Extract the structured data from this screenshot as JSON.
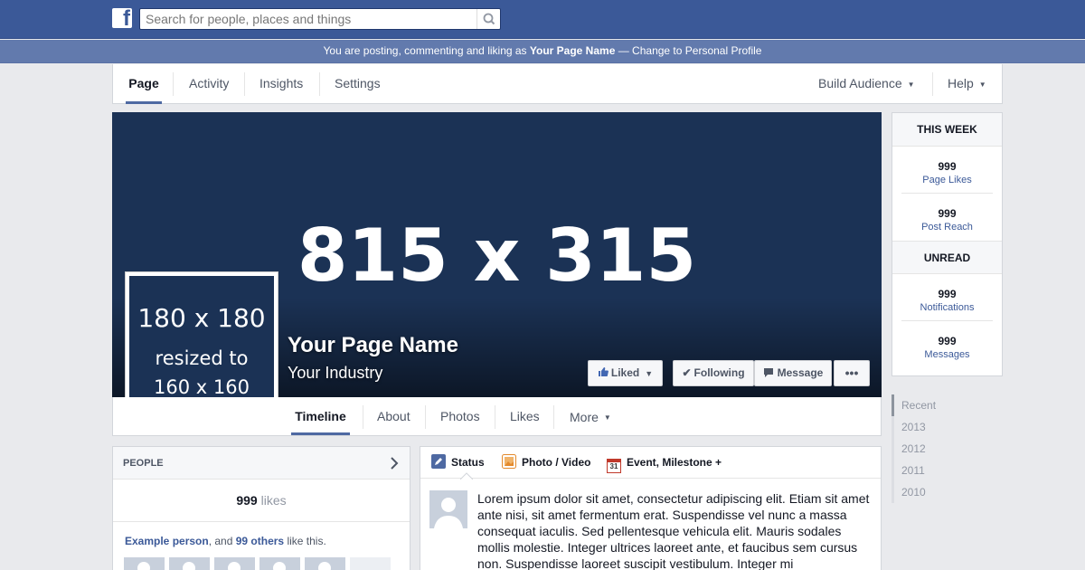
{
  "topbar": {
    "logo_letter": "f",
    "search_placeholder": "Search for people, places and things",
    "brand_color": "#3b5998"
  },
  "notice": {
    "prefix": "You are posting, commenting and liking as",
    "page_name": "Your Page Name",
    "suffix": "— Change to Personal Profile"
  },
  "admin_tabs": {
    "page": "Page",
    "activity": "Activity",
    "insights": "Insights",
    "settings": "Settings",
    "build_audience": "Build Audience",
    "help": "Help"
  },
  "cover": {
    "dimensions": "815 x 315",
    "profile_line1": "180 x 180",
    "profile_line2": "resized to",
    "profile_line3": "160 x 160",
    "page_name": "Your Page Name",
    "industry": "Your Industry"
  },
  "cover_buttons": {
    "liked": "Liked",
    "following": "Following",
    "message": "Message",
    "more": "•••"
  },
  "timeline_tabs": {
    "timeline": "Timeline",
    "about": "About",
    "photos": "Photos",
    "likes": "Likes",
    "more": "More"
  },
  "this_week": {
    "title": "THIS WEEK",
    "page_likes_value": "999",
    "page_likes_label": "Page Likes",
    "post_reach_value": "999",
    "post_reach_label": "Post Reach"
  },
  "unread": {
    "title": "UNREAD",
    "notifications_value": "999",
    "notifications_label": "Notifications",
    "messages_value": "999",
    "messages_label": "Messages"
  },
  "years": [
    "Recent",
    "2013",
    "2012",
    "2011",
    "2010"
  ],
  "people": {
    "title": "PEOPLE",
    "likes_count": "999",
    "likes_word": "likes",
    "example_person": "Example person",
    "and_text": ", and",
    "others": "99 others",
    "like_this": "like this."
  },
  "composer": {
    "status": "Status",
    "photo_video": "Photo / Video",
    "event": "Event, Milestone +",
    "calendar_day": "31",
    "post_text": "Lorem ipsum dolor sit amet, consectetur adipiscing elit. Etiam sit amet ante nisi, sit amet fermentum erat. Suspendisse vel nunc a massa consequat iaculis. Sed pellentesque vehicula elit. Mauris sodales mollis molestie. Integer ultrices laoreet ante, et faucibus sem cursus non. Suspendisse laoreet suscipit vestibulum. Integer mi"
  }
}
